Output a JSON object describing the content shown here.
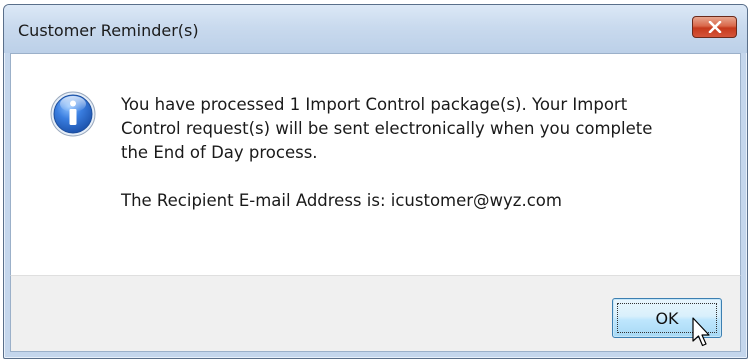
{
  "window": {
    "title": "Customer Reminder(s)",
    "close_icon": "close-icon"
  },
  "message": {
    "icon": "info-icon",
    "line_1": "You have processed 1 Import Control package(s). Your Import",
    "line_2": "Control request(s) will be sent electronically when you complete",
    "line_3": "the End of Day process.",
    "recipient": "The Recipient E-mail Address is: icustomer@wyz.com"
  },
  "buttons": {
    "ok_label": "OK"
  },
  "colors": {
    "titlebar": "#c9daee",
    "close_button": "#c5391c",
    "ok_button_border": "#3c7fb1",
    "info_icon_blue": "#2a62c9"
  }
}
